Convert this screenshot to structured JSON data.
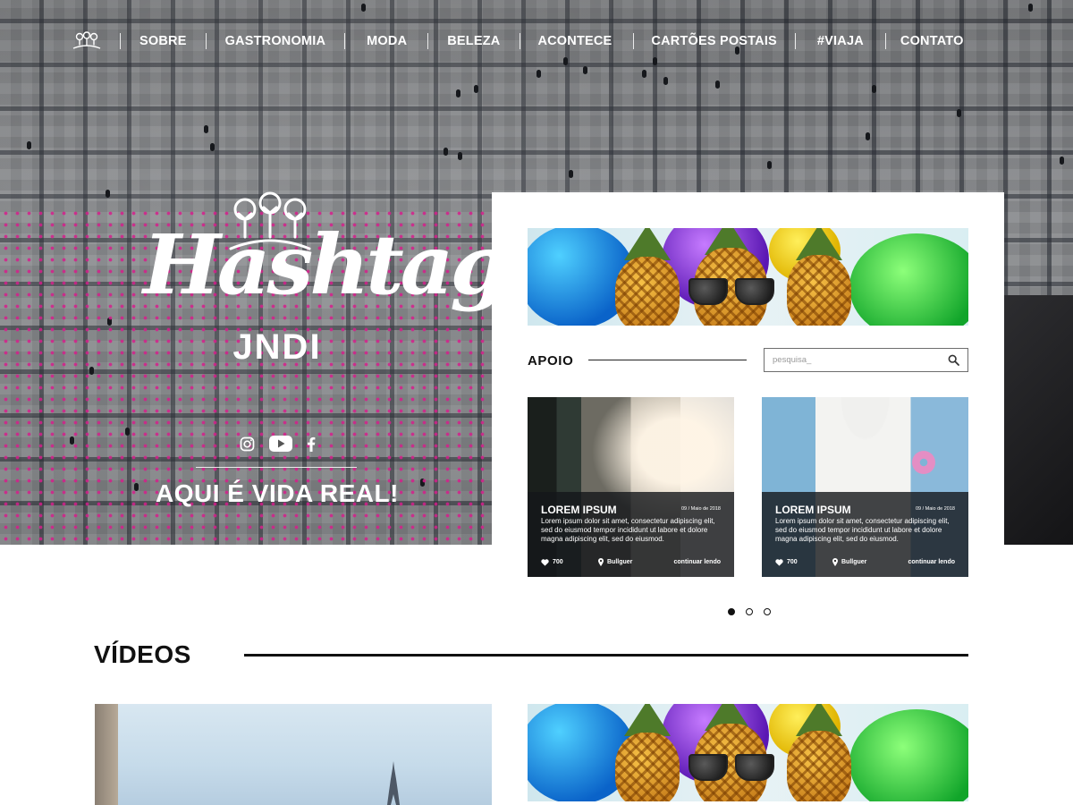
{
  "nav": {
    "logo_icon": "trees-logo-icon",
    "items": [
      {
        "label": "SOBRE"
      },
      {
        "label": "GASTRONOMIA"
      },
      {
        "label": "MODA"
      },
      {
        "label": "BELEZA"
      },
      {
        "label": "ACONTECE"
      },
      {
        "label": "CARTÕES POSTAIS"
      },
      {
        "label": "#VIAJA"
      },
      {
        "label": "CONTATO"
      }
    ]
  },
  "hero": {
    "brand_script": "Hashtag",
    "brand_sub": "JNDI",
    "social": [
      "instagram-icon",
      "youtube-icon",
      "facebook-icon"
    ],
    "tagline": "AQUI É VIDA REAL!"
  },
  "sidebar": {
    "section_label": "APOIO",
    "search": {
      "placeholder": "pesquisa_",
      "value": ""
    },
    "cards": [
      {
        "title": "LOREM IPSUM",
        "date": "09 / Maio de 2018",
        "text": "Lorem ipsum dolor sit amet, consectetur adipiscing elit, sed do eiusmod tempor incididunt ut labore et dolore magna adipiscing elit, sed do eiusmod.",
        "likes": "700",
        "place": "Bullguer",
        "more": "continuar lendo"
      },
      {
        "title": "LOREM IPSUM",
        "date": "09 / Maio de 2018",
        "text": "Lorem ipsum dolor sit amet, consectetur adipiscing elit, sed do eiusmod tempor incididunt ut labore et dolore magna adipiscing elit, sed do eiusmod.",
        "likes": "700",
        "place": "Bullguer",
        "more": "continuar lendo"
      }
    ],
    "pager": {
      "pages": 3,
      "active": 1
    }
  },
  "videos": {
    "title": "VÍDEOS"
  },
  "colors": {
    "accent_pink": "#d61e8c",
    "text_dark": "#111111",
    "overlay_dark": "#14161a"
  }
}
